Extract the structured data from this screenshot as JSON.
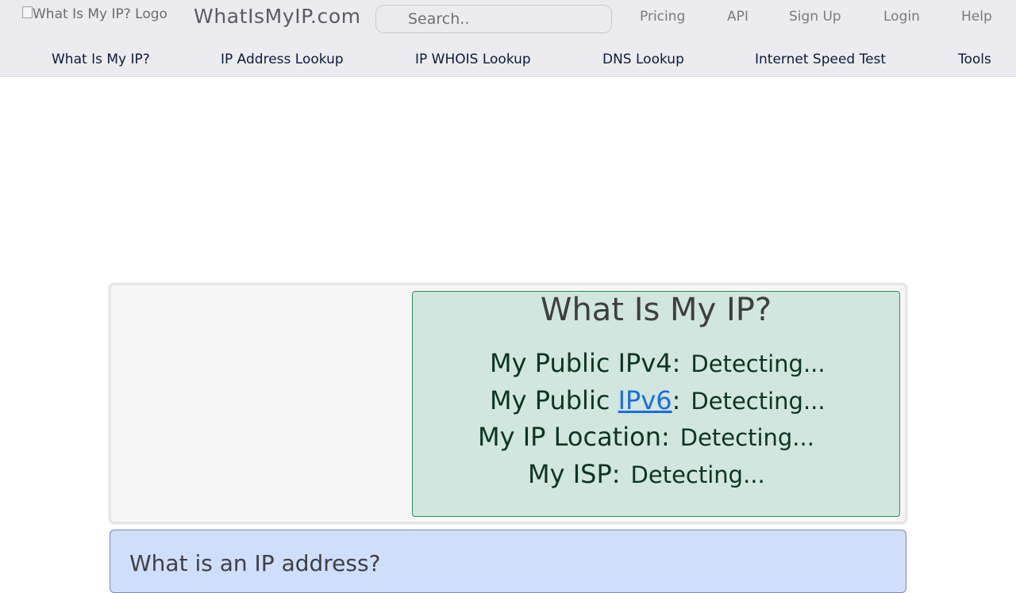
{
  "header": {
    "logo_alt": "What Is My IP? Logo",
    "brand": "WhatIsMyIP.com",
    "search_placeholder": "Search..",
    "links": [
      "Pricing",
      "API",
      "Sign Up",
      "Login",
      "Help"
    ]
  },
  "nav": {
    "items": [
      "What Is My IP?",
      "IP Address Lookup",
      "IP WHOIS Lookup",
      "DNS Lookup",
      "Internet Speed Test",
      "Tools"
    ]
  },
  "ipinfo": {
    "title": "What Is My IP?",
    "ipv4_label": "My Public IPv4:",
    "ipv4_value": "Detecting...",
    "ipv6_prefix": "My Public ",
    "ipv6_link": "IPv6",
    "ipv6_suffix": ":",
    "ipv6_value": "Detecting...",
    "location_label": "My IP Location:",
    "location_value": "Detecting...",
    "isp_label": "My ISP:",
    "isp_value": "Detecting..."
  },
  "info": {
    "heading": "What is an IP address?"
  },
  "colors": {
    "header_bg": "#ecebf0",
    "ip_box_bg": "#d1e6de",
    "ip_box_border": "#2f8c5c",
    "info_bg": "#cfdffb",
    "link": "#1a6edd"
  }
}
